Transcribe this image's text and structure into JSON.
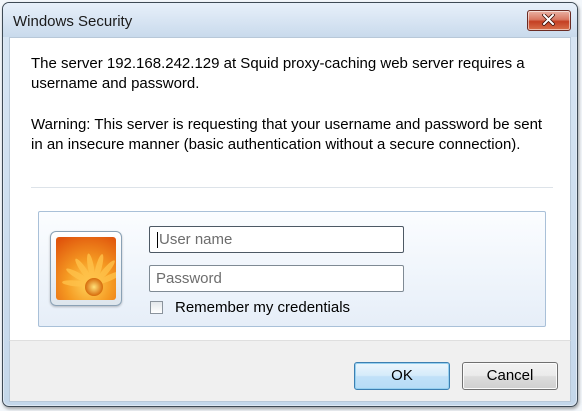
{
  "window": {
    "title": "Windows Security"
  },
  "message": {
    "server_prompt": "The server 192.168.242.129 at Squid proxy-caching web server requires a username and password.",
    "warning": "Warning: This server is requesting that your username and password be sent in an insecure manner (basic authentication without a secure connection)."
  },
  "credentials": {
    "username": {
      "value": "",
      "placeholder": "User name"
    },
    "password": {
      "value": "",
      "placeholder": "Password"
    },
    "remember": {
      "label": "Remember my credentials",
      "checked": false
    }
  },
  "buttons": {
    "ok_label": "OK",
    "cancel_label": "Cancel"
  },
  "icons": {
    "close": "close-icon",
    "avatar": "user-tile-flower-icon"
  },
  "colors": {
    "accent_button_border": "#3c7fb1",
    "close_button": "#c43f22",
    "avatar_orange": "#f07a1a"
  }
}
